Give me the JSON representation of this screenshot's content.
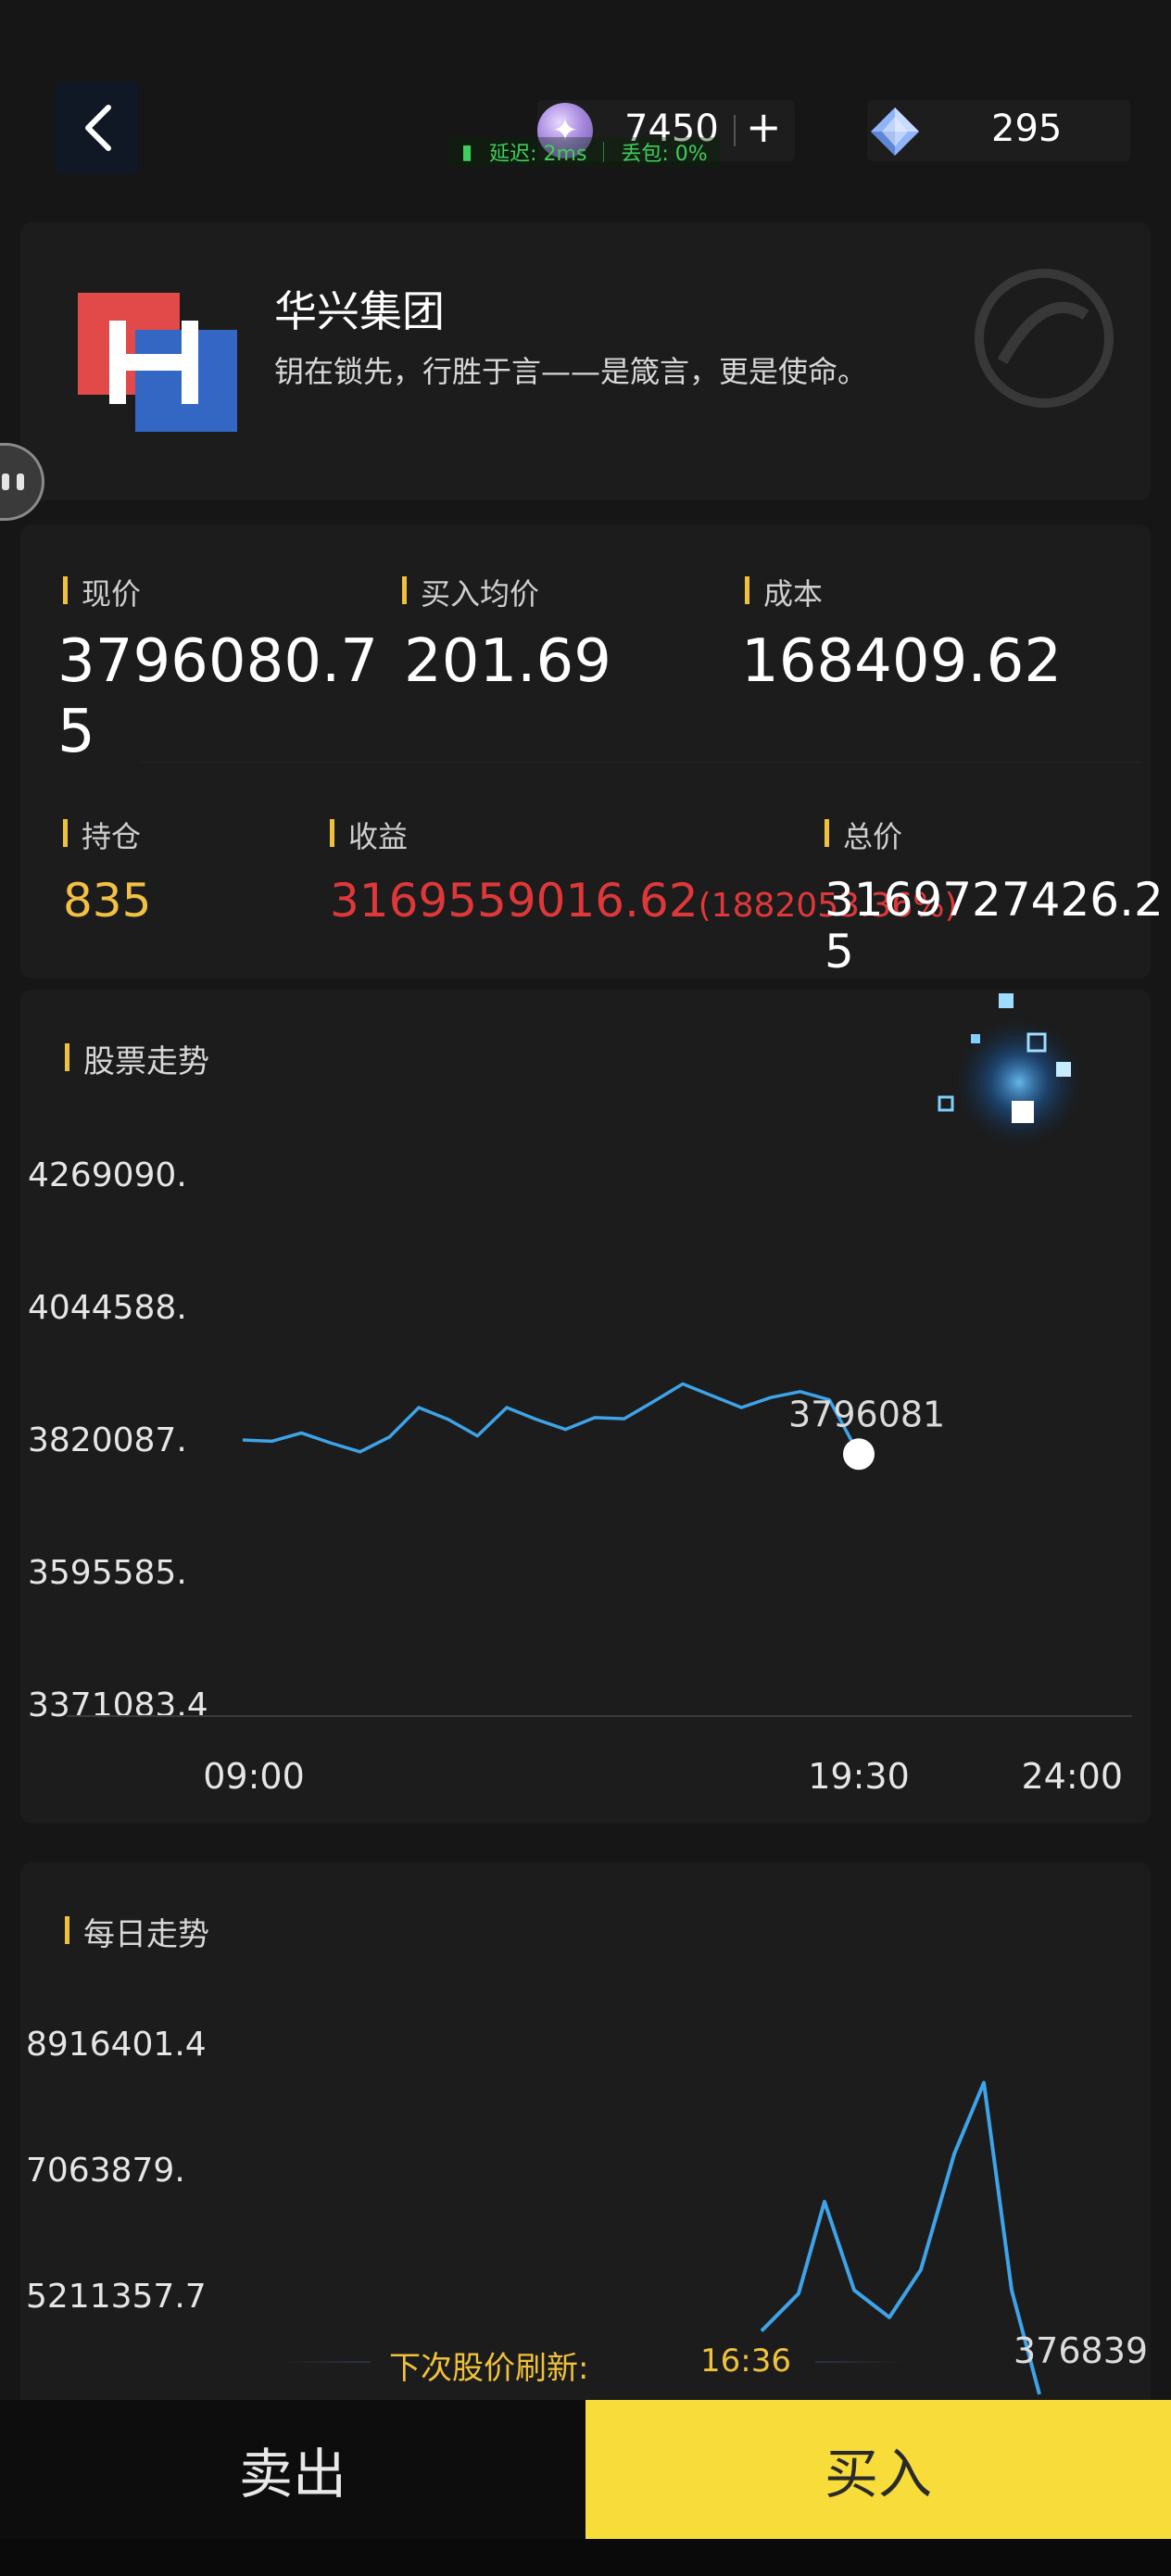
{
  "header": {
    "coins": "7450",
    "add_symbol": "+",
    "gems": "295",
    "net_latency": "延迟: 2ms",
    "net_loss": "丢包: 0%"
  },
  "company": {
    "name": "华兴集团",
    "slogan": "钥在锁先，行胜于言——是箴言，更是使命。",
    "logo_colors": [
      "#e24a4a",
      "#3466c4"
    ]
  },
  "stats": {
    "price_label": "现价",
    "price_value_line1": "3796080.7",
    "price_value_line2": "5",
    "avg_label": "买入均价",
    "avg_value": "201.69",
    "cost_label": "成本",
    "cost_value": "168409.62",
    "holding_label": "持仓",
    "holding_value": "835",
    "profit_label": "收益",
    "profit_value": "3169559016.62",
    "profit_pct": "(1882053.36%)",
    "total_label": "总价",
    "total_value_line1": "3169727426.2",
    "total_value_line2": "5"
  },
  "chart_data": [
    {
      "type": "line",
      "title": "股票走势",
      "y_tick_labels": [
        "4269090.",
        "4044588.",
        "3820087.",
        "3595585.",
        "3371083.4"
      ],
      "y_ticks": [
        4269090,
        4044588,
        3820087,
        3595585,
        3371083.4
      ],
      "ylim": [
        3371083.4,
        4269090
      ],
      "x_tick_labels": [
        "09:00",
        "19:30",
        "24:00"
      ],
      "x_ticks": [
        0,
        630,
        900
      ],
      "x_unit": "minutes since 09:00",
      "x": [
        0,
        30,
        60,
        90,
        120,
        150,
        180,
        210,
        240,
        270,
        300,
        330,
        360,
        390,
        420,
        450,
        480,
        510,
        540,
        570,
        600,
        630
      ],
      "values": [
        3820000,
        3818000,
        3832000,
        3815000,
        3800000,
        3825000,
        3875000,
        3855000,
        3827000,
        3875000,
        3855000,
        3838000,
        3858000,
        3856000,
        3885000,
        3915000,
        3895000,
        3875000,
        3892000,
        3902000,
        3888000,
        3796081
      ],
      "last_point_label": "3796081",
      "color": "#3ea3e8"
    },
    {
      "type": "line",
      "title": "每日走势",
      "y_tick_labels": [
        "8916401.4",
        "7063879.",
        "5211357.7"
      ],
      "y_ticks": [
        8916401.4,
        7063879,
        5211357.7
      ],
      "values": [
        4700000,
        5250000,
        6600000,
        5300000,
        4900000,
        5600000,
        7300000,
        8350000,
        5300000,
        3768397
      ],
      "last_point_label": "376839",
      "color": "#3ea3e8"
    }
  ],
  "refresh": {
    "label": "下次股价刷新:",
    "time": "16:36"
  },
  "actions": {
    "sell_label": "卖出",
    "buy_label": "买入"
  },
  "colors": {
    "accent_gold": "#f0c23c",
    "profit_red": "#e0383a",
    "buy_yellow": "#f7dc3a",
    "line_blue": "#3ea3e8"
  }
}
